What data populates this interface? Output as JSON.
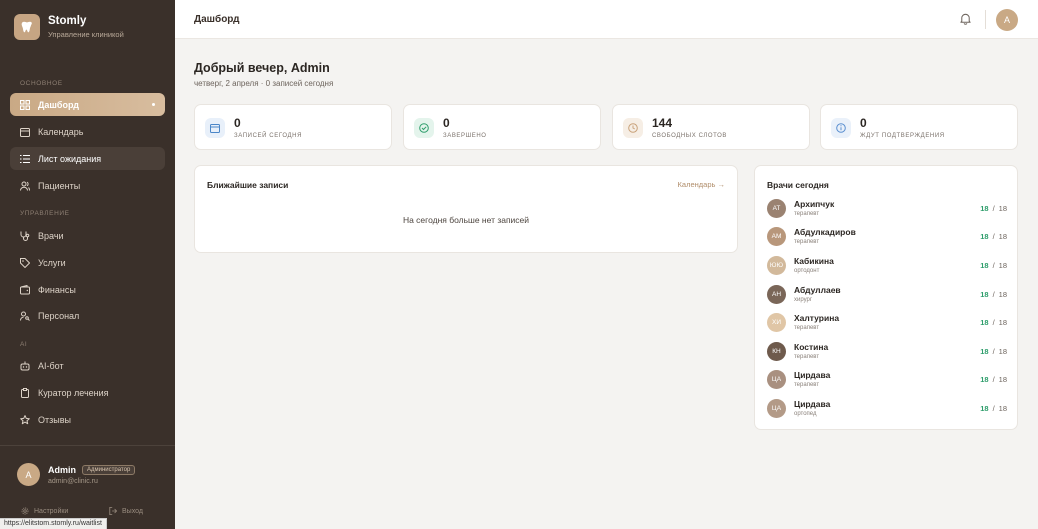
{
  "brand": {
    "name": "Stomly",
    "subtitle": "Управление клиникой"
  },
  "sidebar": {
    "sections": {
      "main": "ОСНОВНОЕ",
      "manage": "УПРАВЛЕНИЕ",
      "ai": "AI"
    },
    "items": [
      {
        "label": "Дашборд",
        "icon": "grid-icon"
      },
      {
        "label": "Календарь",
        "icon": "calendar-icon"
      },
      {
        "label": "Лист ожидания",
        "icon": "list-icon"
      },
      {
        "label": "Пациенты",
        "icon": "users-icon"
      },
      {
        "label": "Врачи",
        "icon": "stethoscope-icon"
      },
      {
        "label": "Услуги",
        "icon": "tag-icon"
      },
      {
        "label": "Финансы",
        "icon": "wallet-icon"
      },
      {
        "label": "Персонал",
        "icon": "person-key-icon"
      },
      {
        "label": "AI-бот",
        "icon": "robot-icon"
      },
      {
        "label": "Куратор лечения",
        "icon": "clipboard-icon"
      },
      {
        "label": "Отзывы",
        "icon": "star-icon"
      }
    ],
    "user": {
      "avatar": "A",
      "name": "Admin",
      "role": "Администратор",
      "email": "admin@clinic.ru"
    },
    "settings": "Настройки",
    "logout": "Выход"
  },
  "status_url": "https://elitstom.stomly.ru/waitlist",
  "topbar": {
    "title": "Дашборд",
    "avatar": "A"
  },
  "greeting": {
    "title": "Добрый вечер, Admin",
    "subtitle": "четверг, 2 апреля · 0 записей сегодня"
  },
  "stats": [
    {
      "value": "0",
      "label": "ЗАПИСЕЙ СЕГОДНЯ",
      "icon": "calendar-icon",
      "color": "#4a86c8",
      "bg": "#e8f0fa"
    },
    {
      "value": "0",
      "label": "ЗАВЕРШЕНО",
      "icon": "check-circle-icon",
      "color": "#2f9e6c",
      "bg": "#e4f4ec"
    },
    {
      "value": "144",
      "label": "СВОБОДНЫХ СЛОТОВ",
      "icon": "clock-icon",
      "color": "#c9a27a",
      "bg": "#f6eee5"
    },
    {
      "value": "0",
      "label": "ЖДУТ ПОДТВЕРЖДЕНИЯ",
      "icon": "info-icon",
      "color": "#5a8fd0",
      "bg": "#eaf1fa"
    }
  ],
  "upcoming": {
    "title": "Ближайшие записи",
    "link": "Календарь →",
    "empty": "На сегодня больше нет записей"
  },
  "doctors": {
    "title": "Врачи сегодня",
    "list": [
      {
        "initials": "АТ",
        "name": "Архипчук",
        "role": "терапевт",
        "free": "18",
        "total": "18",
        "color": "#9a8271"
      },
      {
        "initials": "АМ",
        "name": "Абдулкадиров",
        "role": "терапевт",
        "free": "18",
        "total": "18",
        "color": "#b8977b"
      },
      {
        "initials": "ЮЮ",
        "name": "Кабикина",
        "role": "ортодонт",
        "free": "18",
        "total": "18",
        "color": "#d2b99b"
      },
      {
        "initials": "АН",
        "name": "Абдуллаев",
        "role": "хирург",
        "free": "18",
        "total": "18",
        "color": "#7a6658"
      },
      {
        "initials": "ХИ",
        "name": "Халтурина",
        "role": "терапевт",
        "free": "18",
        "total": "18",
        "color": "#e0c6a6"
      },
      {
        "initials": "КН",
        "name": "Костина",
        "role": "терапевт",
        "free": "18",
        "total": "18",
        "color": "#6e5a4c"
      },
      {
        "initials": "ЦА",
        "name": "Цирдава",
        "role": "терапевт",
        "free": "18",
        "total": "18",
        "color": "#a99080"
      },
      {
        "initials": "ЦА",
        "name": "Цирдава",
        "role": "ортопед",
        "free": "18",
        "total": "18",
        "color": "#b39a87"
      }
    ]
  }
}
